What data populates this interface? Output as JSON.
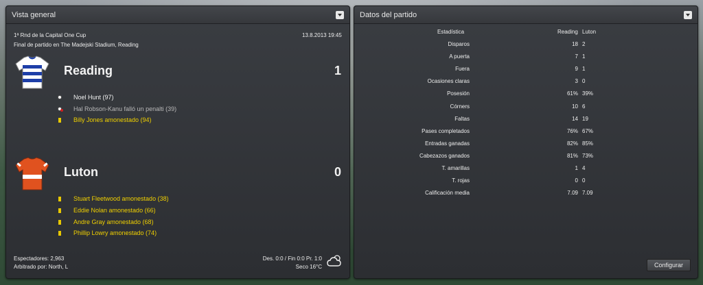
{
  "overview": {
    "title": "Vista general",
    "competition": "1ª Rnd de la Capital One Cup",
    "datetime": "13.8.2013 19:45",
    "venue": "Final de partido en The Madejski Stadium, Reading",
    "home": {
      "name": "Reading",
      "score": "1",
      "kit_colors": [
        "#1e3fa8",
        "#ffffff"
      ],
      "events": [
        {
          "icon": "goal-icon",
          "text": "Noel Hunt (97)",
          "style": "white"
        },
        {
          "icon": "missed-penalty-icon",
          "text": "Hal Robson-Kanu falló un penalti (39)",
          "style": "grey"
        },
        {
          "icon": "yellow-card-icon",
          "text": "Billy Jones amonestado (94)",
          "style": "yellow"
        }
      ]
    },
    "away": {
      "name": "Luton",
      "score": "0",
      "kit_colors": [
        "#e0521f",
        "#ffffff"
      ],
      "events": [
        {
          "icon": "yellow-card-icon",
          "text": "Stuart Fleetwood amonestado (38)",
          "style": "yellow"
        },
        {
          "icon": "yellow-card-icon",
          "text": "Eddie Nolan amonestado (66)",
          "style": "yellow"
        },
        {
          "icon": "yellow-card-icon",
          "text": "Andre Gray amonestado (68)",
          "style": "yellow"
        },
        {
          "icon": "yellow-card-icon",
          "text": "Phillip Lowry amonestado (74)",
          "style": "yellow"
        }
      ]
    },
    "attendance": "Espectadores: 2,963",
    "referee": "Arbitrado por: North, L",
    "extra_time": "Des. 0:0 / Fin 0:0 Pr. 1:0",
    "weather": "Seco 16°C",
    "weather_icon": "cloud-icon"
  },
  "stats": {
    "title": "Datos del partido",
    "header": {
      "label": "Estadística",
      "home": "Reading",
      "away": "Luton"
    },
    "rows": [
      {
        "label": "Disparos",
        "home": "18",
        "away": "2"
      },
      {
        "label": "A puerta",
        "home": "7",
        "away": "1"
      },
      {
        "label": "Fuera",
        "home": "9",
        "away": "1"
      },
      {
        "label": "Ocasiones claras",
        "home": "3",
        "away": "0"
      },
      {
        "label": "Posesión",
        "home": "61%",
        "away": "39%"
      },
      {
        "label": "Córners",
        "home": "10",
        "away": "6"
      },
      {
        "label": "Faltas",
        "home": "14",
        "away": "19"
      },
      {
        "label": "Pases completados",
        "home": "76%",
        "away": "67%"
      },
      {
        "label": "Entradas ganadas",
        "home": "82%",
        "away": "85%"
      },
      {
        "label": "Cabezazos ganados",
        "home": "81%",
        "away": "73%"
      },
      {
        "label": "T. amarillas",
        "home": "1",
        "away": "4"
      },
      {
        "label": "T. rojas",
        "home": "0",
        "away": "0"
      },
      {
        "label": "Calificación media",
        "home": "7.09",
        "away": "7.09"
      }
    ],
    "configure_label": "Configurar"
  }
}
